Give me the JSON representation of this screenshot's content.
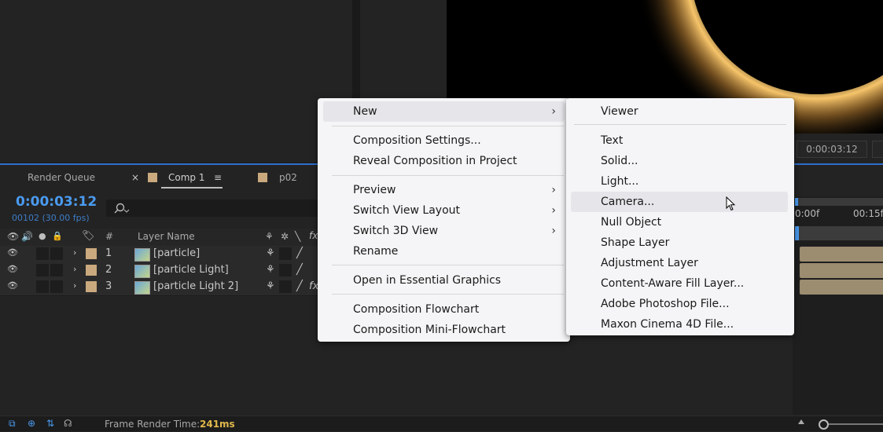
{
  "timeline": {
    "tabs": [
      {
        "label": "Render Queue"
      },
      {
        "label": "Comp 1",
        "close": "×",
        "menu": "≡"
      },
      {
        "label": "p02"
      }
    ],
    "timecode": "0:00:03:12",
    "frame_fps": "00102 (30.00 fps)",
    "columns": {
      "hash": "#",
      "layer_name": "Layer Name"
    },
    "layers": [
      {
        "index": "1",
        "name": "[particle]"
      },
      {
        "index": "2",
        "name": "[particle Light]"
      },
      {
        "index": "3",
        "name": "[particle Light 2]"
      }
    ],
    "ruler": {
      "t0": "0:00f",
      "t1": "00:15f"
    }
  },
  "viewer": {
    "timecode": "0:00:03:12"
  },
  "status_bar": {
    "label": "Frame Render Time:",
    "value": "241ms"
  },
  "context_menu": {
    "items": [
      {
        "label": "New",
        "submenu": true
      },
      {
        "label": "Composition Settings..."
      },
      {
        "label": "Reveal Composition in Project"
      },
      {
        "label": "Preview",
        "submenu": true
      },
      {
        "label": "Switch View Layout",
        "submenu": true
      },
      {
        "label": "Switch 3D View",
        "submenu": true
      },
      {
        "label": "Rename"
      },
      {
        "label": "Open in Essential Graphics"
      },
      {
        "label": "Composition Flowchart"
      },
      {
        "label": "Composition Mini-Flowchart"
      }
    ],
    "arrow": "›"
  },
  "submenu": {
    "items": [
      {
        "label": "Viewer"
      },
      {
        "label": "Text"
      },
      {
        "label": "Solid..."
      },
      {
        "label": "Light..."
      },
      {
        "label": "Camera...",
        "hovered": true
      },
      {
        "label": "Null Object"
      },
      {
        "label": "Shape Layer"
      },
      {
        "label": "Adjustment Layer"
      },
      {
        "label": "Content-Aware Fill Layer..."
      },
      {
        "label": "Adobe Photoshop File..."
      },
      {
        "label": "Maxon Cinema 4D File..."
      }
    ]
  },
  "colors": {
    "accent": "#4a9bf0",
    "label_swatch": "#c9a97d",
    "render_time": "#e0b84a"
  }
}
